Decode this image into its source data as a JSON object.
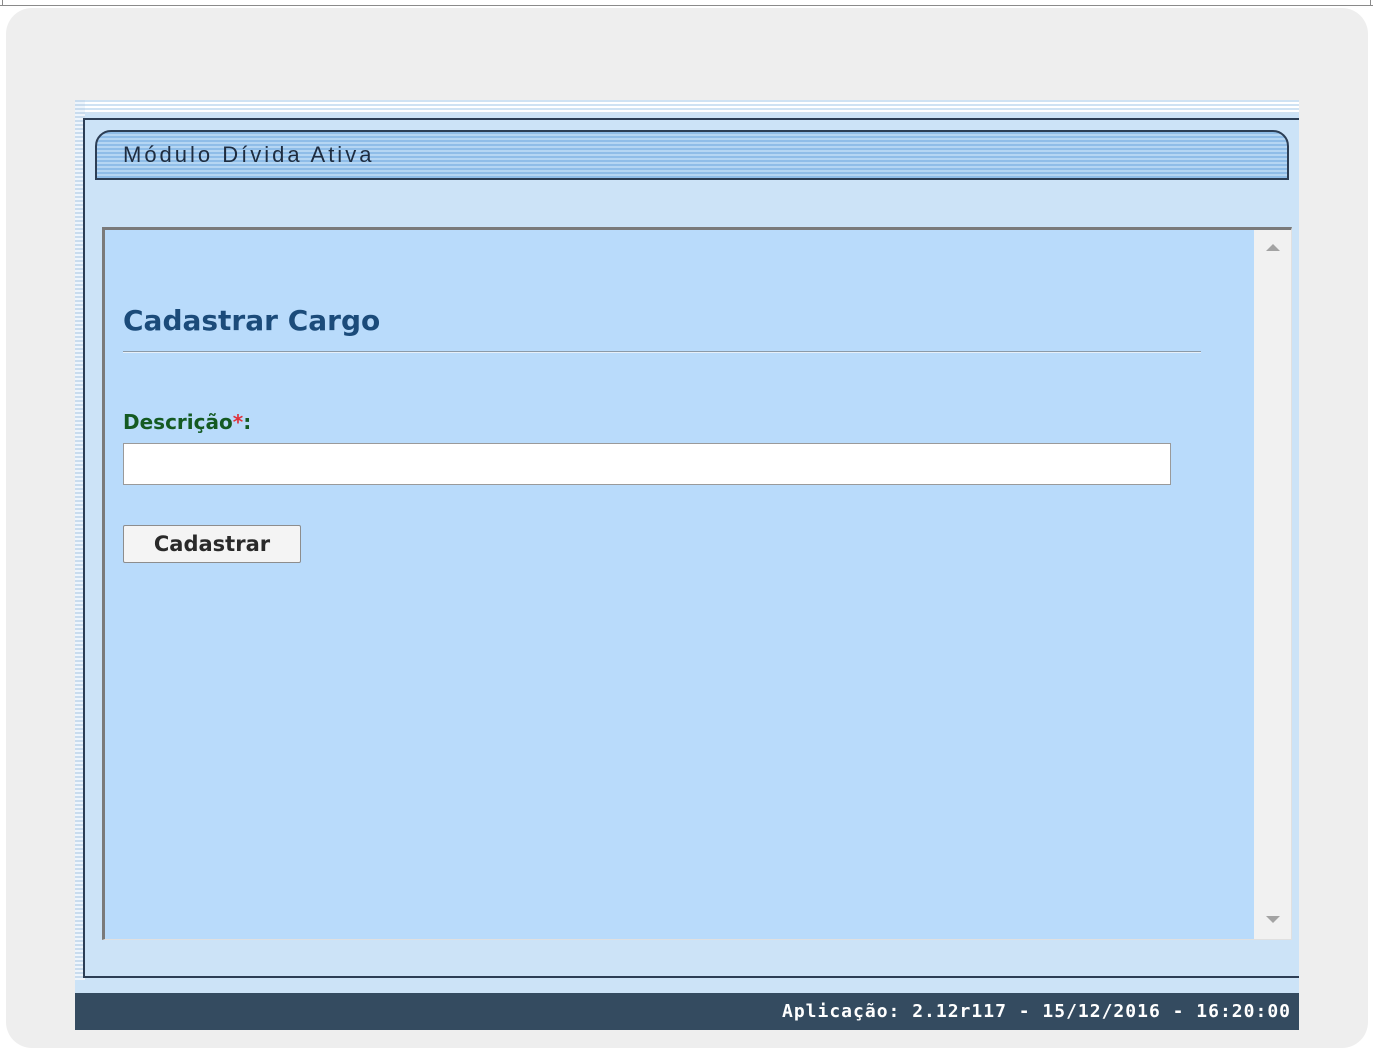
{
  "module": {
    "title": "Módulo Dívida Ativa"
  },
  "form": {
    "title": "Cadastrar Cargo",
    "description_label": "Descrição",
    "required_mark": "*",
    "label_suffix": ":",
    "description_value": "",
    "submit_label": "Cadastrar"
  },
  "status_bar": {
    "text": "Aplicação: 2.12r117 - 15/12/2016 - 16:20:00"
  },
  "colors": {
    "frame_background": "#cce3f7",
    "panel_background": "#b9dbfb",
    "title_color": "#1b4b7a",
    "label_color": "#145a22",
    "required_color": "#e0303a",
    "status_bar_background": "#344b60"
  },
  "icons": {
    "scroll_up": "scroll-up-arrow-icon",
    "scroll_down": "scroll-down-arrow-icon"
  }
}
